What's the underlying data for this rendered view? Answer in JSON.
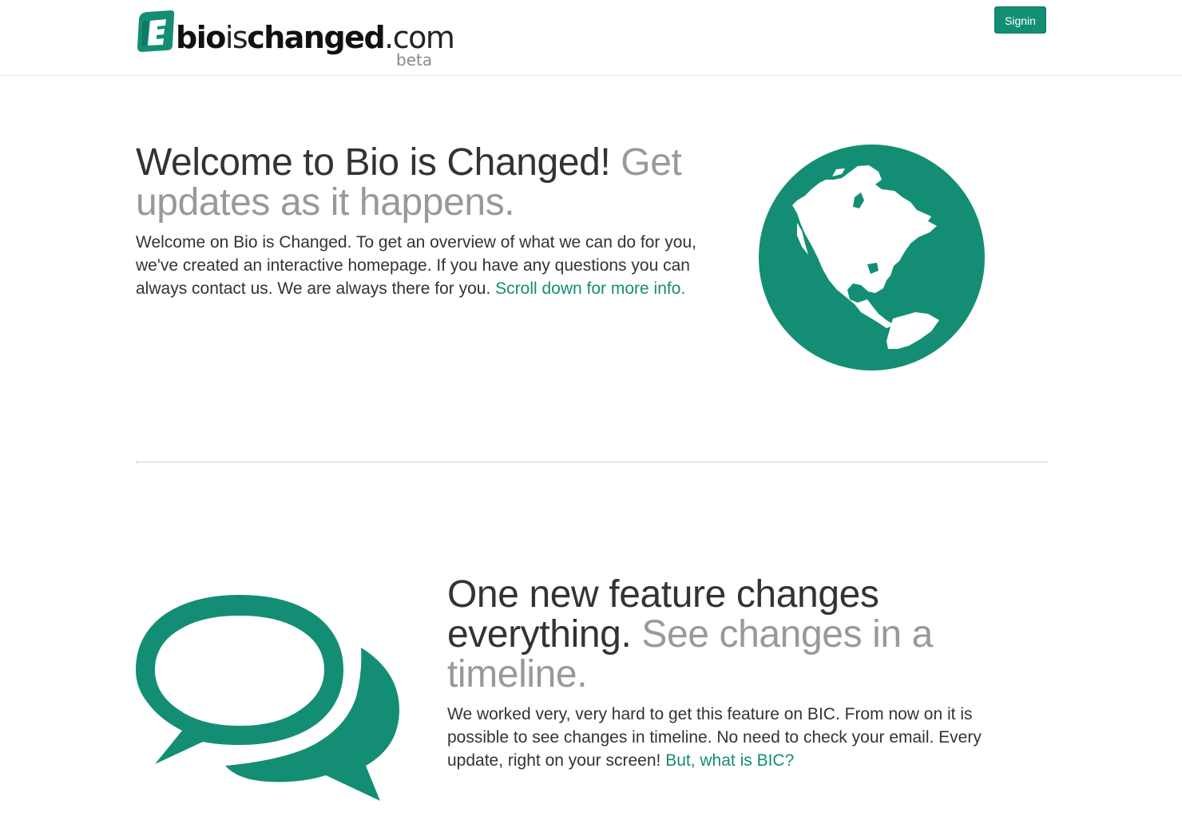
{
  "brand": {
    "name_bold": "bio",
    "name_light": "is",
    "name_bold2": "changed",
    "tld": ".com",
    "tag": "beta",
    "accent_color": "#138e74"
  },
  "nav": {
    "signin_label": "Signin"
  },
  "hero": {
    "heading_main": "Welcome to Bio is Changed!",
    "heading_muted": "Get updates as it happens.",
    "lead_text": "Welcome on Bio is Changed. To get an overview of what we can do for you, we've created an interactive homepage. If you have any questions you can always contact us. We are always there for you.",
    "lead_link": "Scroll down for more info.",
    "image_icon": "globe-americas-icon"
  },
  "feature": {
    "heading_main": "One new feature changes everything.",
    "heading_muted": "See changes in a timeline.",
    "lead_text": "We worked very, very hard to get this feature on BIC. From now on it is possible to see changes in timeline. No need to check your email. Every update, right on your screen!",
    "lead_link": "But, what is BIC?",
    "image_icon": "chat-bubbles-icon"
  }
}
